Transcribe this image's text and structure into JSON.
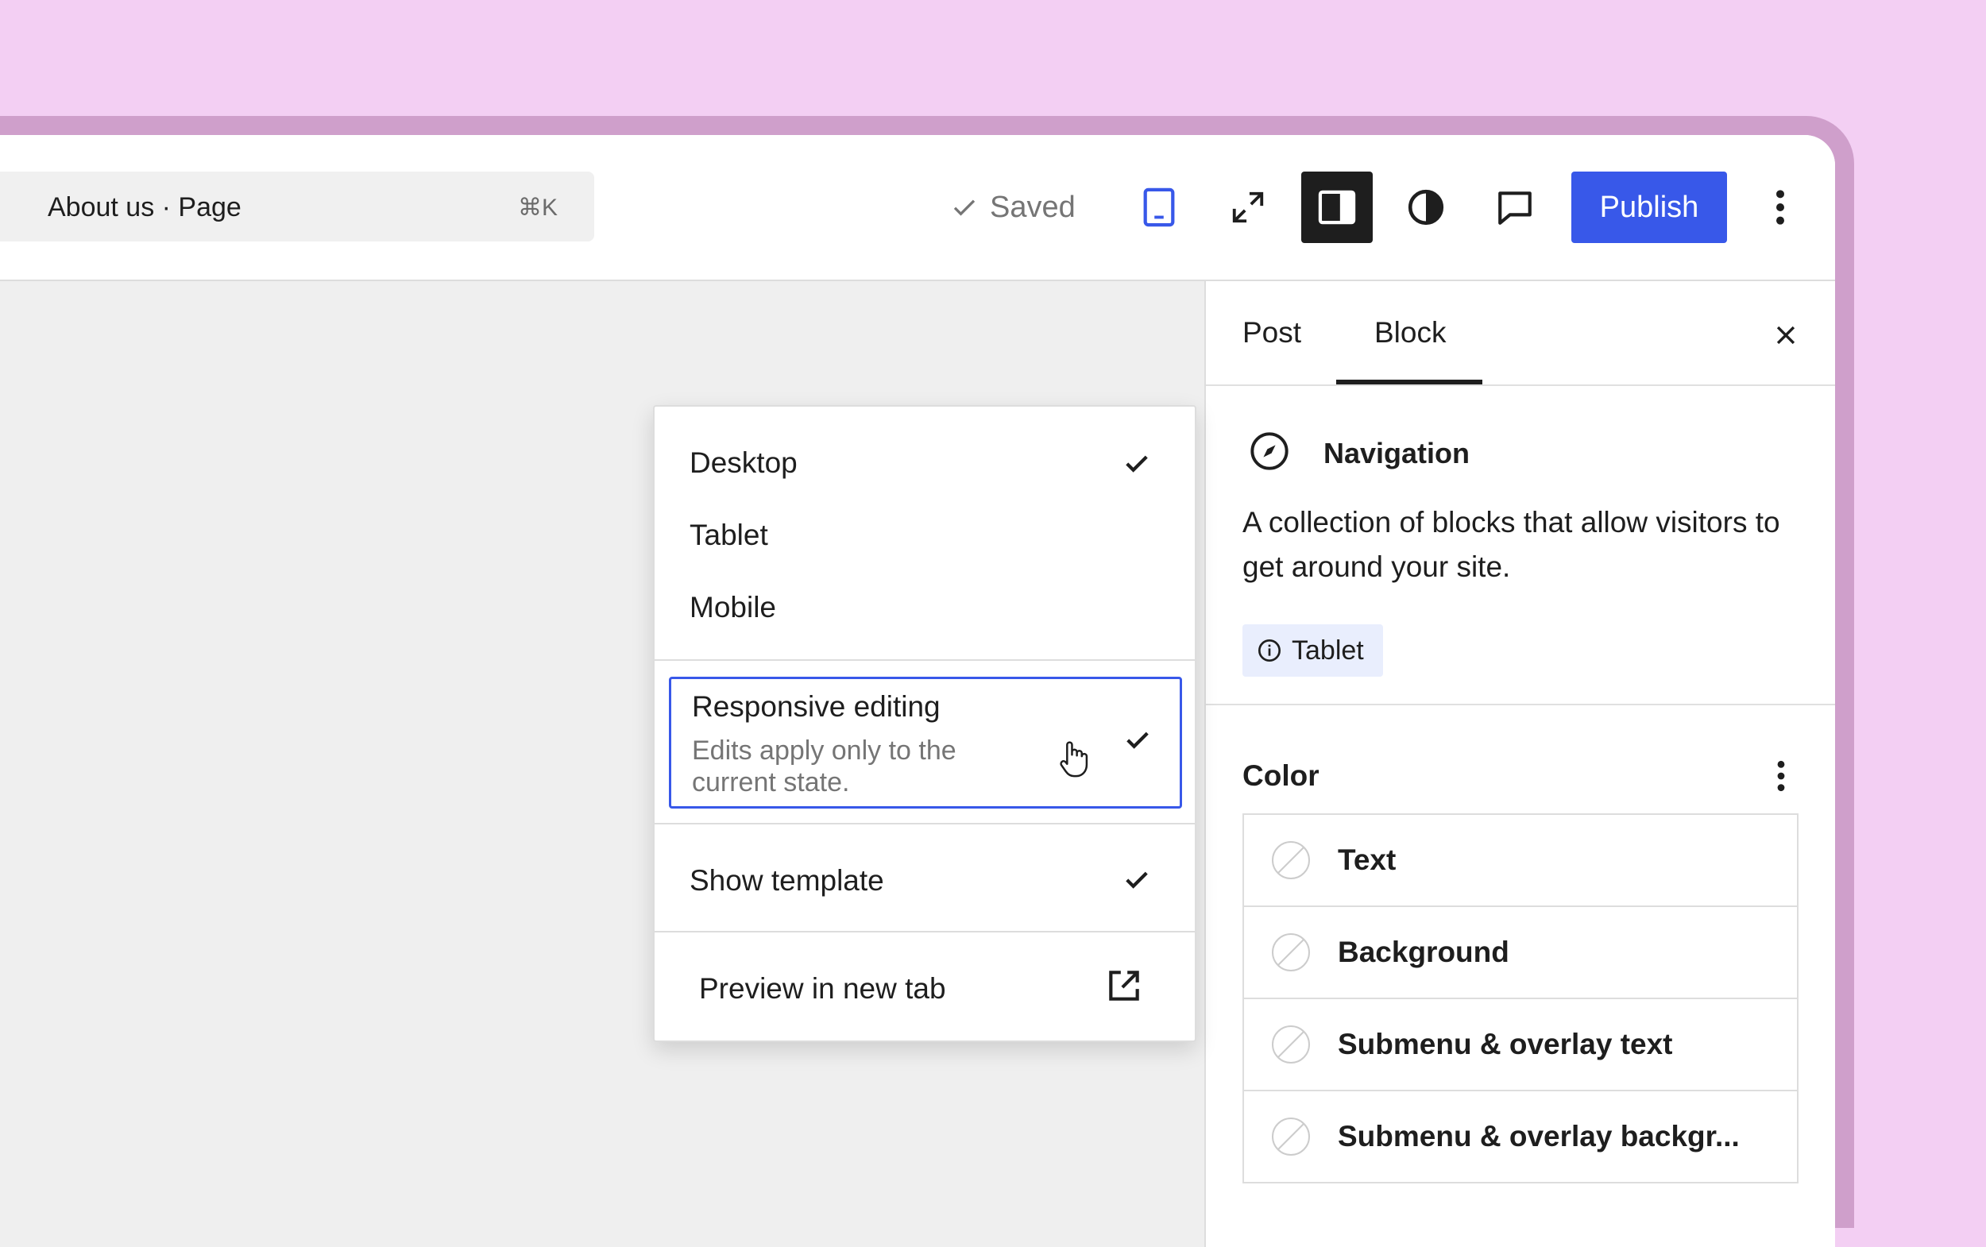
{
  "toolbar": {
    "document_title": "About us · Page",
    "shortcut": "⌘K",
    "saved_label": "Saved",
    "publish_label": "Publish",
    "icons": {
      "device": "tablet-icon",
      "zoom": "fullscreen-icon",
      "sidebar": "sidebar-toggle-icon",
      "styles": "contrast-icon",
      "comments": "comment-icon",
      "more": "more-vertical-icon"
    },
    "accent_color": "#3858e9"
  },
  "preview_menu": {
    "devices": [
      {
        "label": "Desktop",
        "checked": true
      },
      {
        "label": "Tablet",
        "checked": false
      },
      {
        "label": "Mobile",
        "checked": false
      }
    ],
    "responsive_editing": {
      "label": "Responsive editing",
      "description": "Edits apply only to the current state.",
      "checked": true
    },
    "show_template": {
      "label": "Show template",
      "checked": true
    },
    "preview_new_tab": {
      "label": "Preview in new tab",
      "icon": "external-link-icon"
    }
  },
  "sidebar": {
    "tabs": [
      {
        "label": "Post",
        "active": false
      },
      {
        "label": "Block",
        "active": true
      }
    ],
    "block": {
      "name": "Navigation",
      "icon": "compass-icon",
      "description": "A collection of blocks that allow visitors to get around your site.",
      "badge": "Tablet"
    },
    "color_panel": {
      "title": "Color",
      "items": [
        {
          "label": "Text"
        },
        {
          "label": "Background"
        },
        {
          "label": "Submenu & overlay text"
        },
        {
          "label": "Submenu & overlay backgr..."
        }
      ]
    }
  }
}
